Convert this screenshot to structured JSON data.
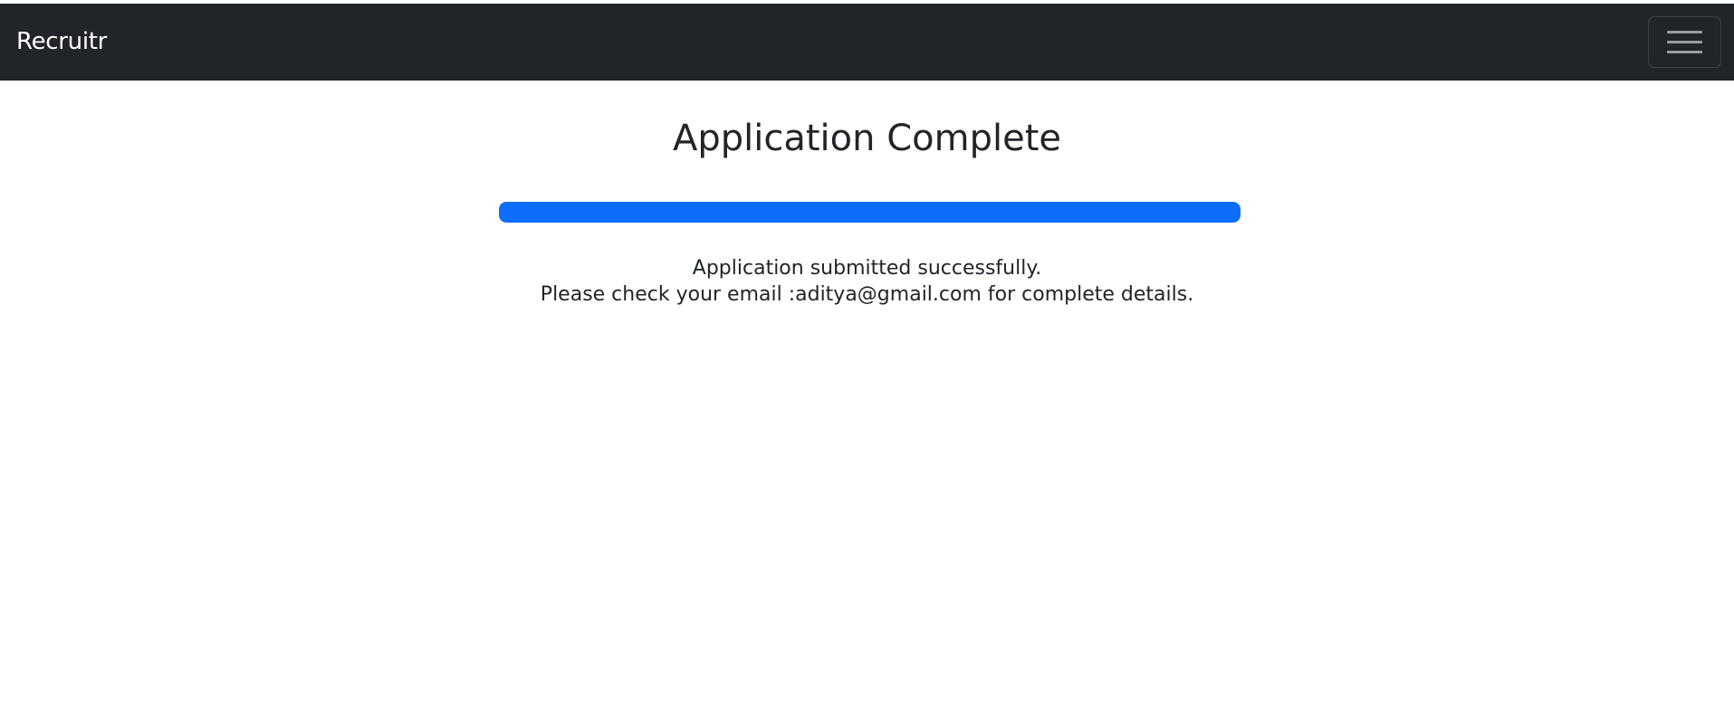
{
  "navbar": {
    "brand": "Recruitr",
    "toggler_icon": "hamburger-menu-icon",
    "background": "#212529"
  },
  "main": {
    "title": "Application Complete",
    "progress": {
      "percent": 100,
      "color": "#0d6efd"
    },
    "message_line1": "Application submitted successfully.",
    "message_line2_prefix": "Please check your email :",
    "email": "aditya@gmail.com",
    "message_line2_suffix": " for complete details."
  }
}
